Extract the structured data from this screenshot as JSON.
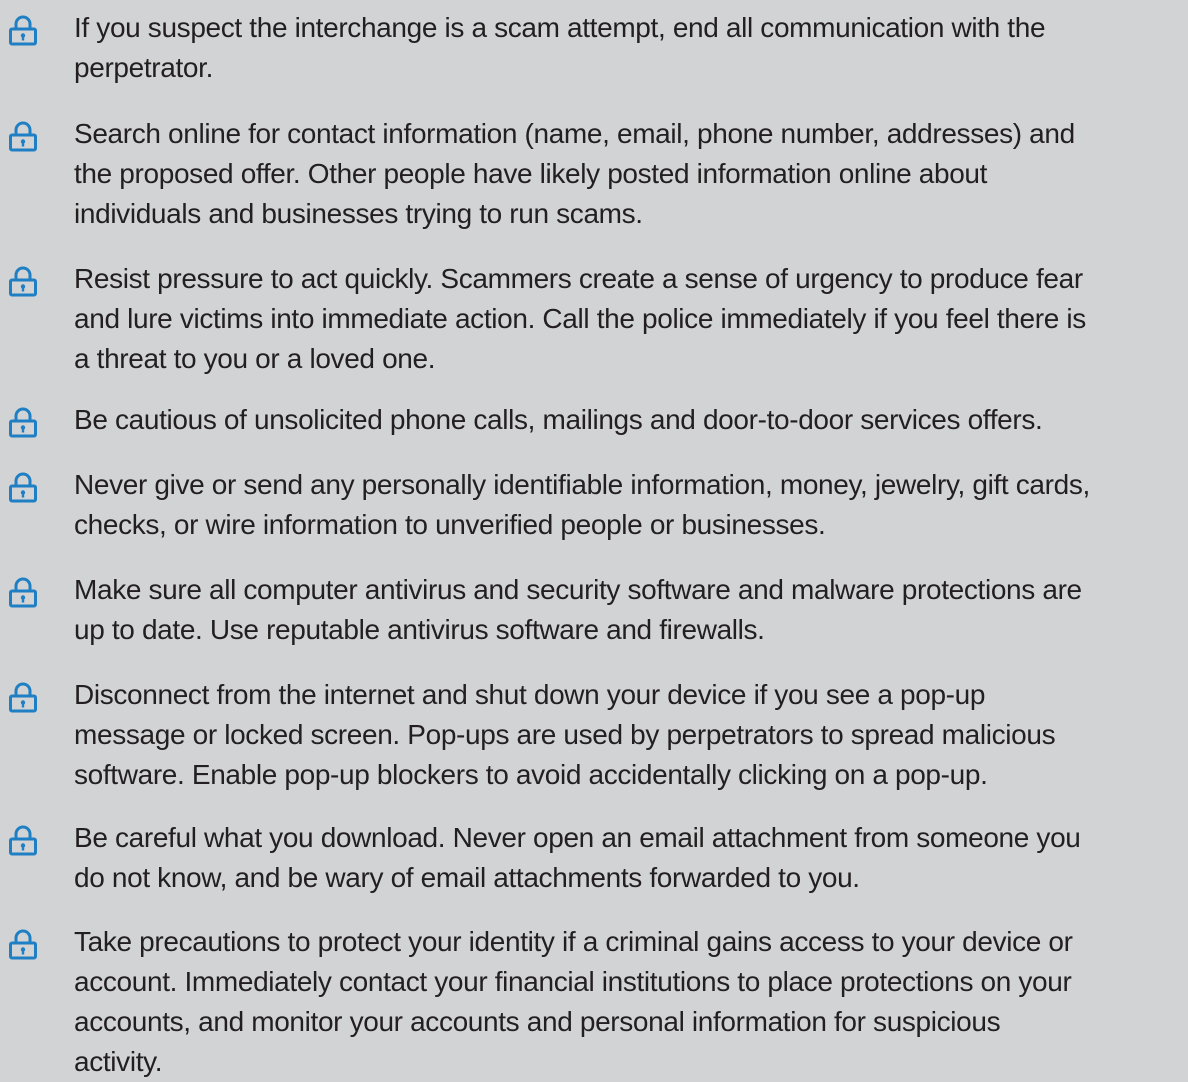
{
  "icon": "lock-icon",
  "colors": {
    "background": "#d1d3d4",
    "text": "#231f20",
    "icon": "#1f7fc4"
  },
  "tips": [
    {
      "lines": [
        "If you suspect the interchange is a scam attempt, end all communication with the",
        "perpetrator."
      ]
    },
    {
      "lines": [
        "Search online for contact information (name, email, phone number, addresses) and",
        "the proposed offer. Other people have likely posted information online about",
        "individuals and businesses trying to run scams."
      ]
    },
    {
      "lines": [
        "Resist pressure to act quickly. Scammers create a sense of urgency to produce fear",
        "and lure victims into immediate action. Call the police immediately if you feel there is",
        "a threat to you or a loved one."
      ]
    },
    {
      "lines": [
        "Be cautious of unsolicited phone calls, mailings and door-to-door services offers."
      ]
    },
    {
      "lines": [
        "Never give or send any personally identifiable information, money, jewelry, gift cards,",
        "checks, or wire information to unverified people or businesses."
      ]
    },
    {
      "lines": [
        "Make sure all computer antivirus and security software and malware protections are",
        "up to date. Use reputable antivirus software and firewalls."
      ]
    },
    {
      "lines": [
        "Disconnect from the internet and shut down your device if you see a pop-up",
        "message or locked screen. Pop-ups are used by perpetrators to spread malicious",
        "software. Enable pop-up blockers to avoid accidentally clicking on a pop-up."
      ]
    },
    {
      "lines": [
        "Be careful what you download. Never open an email attachment from someone you",
        "do not know, and be wary of email attachments forwarded to you."
      ]
    },
    {
      "lines": [
        "Take precautions to protect your identity if a criminal gains access to your device or",
        "account. Immediately contact your financial institutions to place protections on your",
        "accounts, and monitor your accounts and personal information for suspicious",
        "activity."
      ]
    }
  ]
}
